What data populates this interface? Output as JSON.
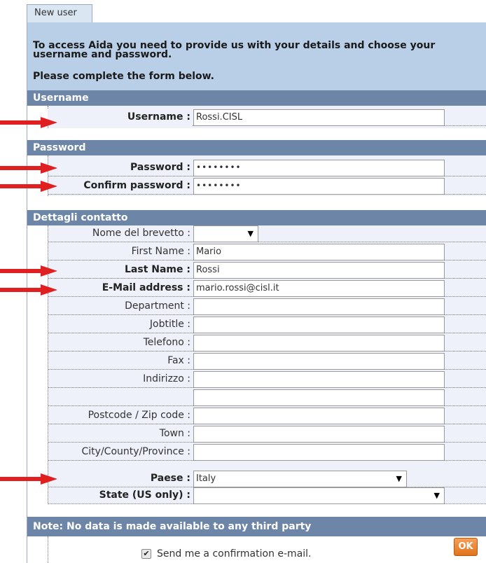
{
  "tab": {
    "label": "New user"
  },
  "intro": {
    "line1": "To access Aida you need to provide us with your details and choose your",
    "line2": "username and password.",
    "line3": "Please complete the form below."
  },
  "sections": {
    "username": "Username",
    "password": "Password",
    "contact": "Dettagli contatto"
  },
  "fields": {
    "username": {
      "label": "Username :",
      "value": "Rossi.CISL"
    },
    "password": {
      "label": "Password :",
      "value": "••••••••"
    },
    "confirm_password": {
      "label": "Confirm password :",
      "value": "••••••••"
    },
    "nome_brevetto": {
      "label": "Nome del brevetto :",
      "value": ""
    },
    "first_name": {
      "label": "First Name :",
      "value": "Mario"
    },
    "last_name": {
      "label": "Last Name :",
      "value": "Rossi"
    },
    "email": {
      "label": "E-Mail address :",
      "value": "mario.rossi@cisl.it"
    },
    "department": {
      "label": "Department :",
      "value": ""
    },
    "jobtitle": {
      "label": "Jobtitle :",
      "value": ""
    },
    "telefono": {
      "label": "Telefono :",
      "value": ""
    },
    "fax": {
      "label": "Fax :",
      "value": ""
    },
    "indirizzo": {
      "label": "Indirizzo :",
      "value": ""
    },
    "indirizzo2": {
      "label": "",
      "value": ""
    },
    "postcode": {
      "label": "Postcode / Zip code :",
      "value": ""
    },
    "town": {
      "label": "Town :",
      "value": ""
    },
    "city": {
      "label": "City/County/Province :",
      "value": ""
    },
    "paese": {
      "label": "Paese :",
      "value": "Italy"
    },
    "state": {
      "label": "State (US only) :",
      "value": ""
    }
  },
  "note": "Note: No data is made available to any third party",
  "confirm_email": {
    "checked_glyph": "✔",
    "label": "Send me a confirmation e-mail."
  },
  "ok_button": "OK",
  "colors": {
    "section_header": "#6d86a7",
    "intro_bg": "#b8cfe7",
    "row_bg": "#eef1fa",
    "arrow": "#e02020",
    "ok_button": "#e8811f"
  },
  "select_arrow_icon": "▼"
}
